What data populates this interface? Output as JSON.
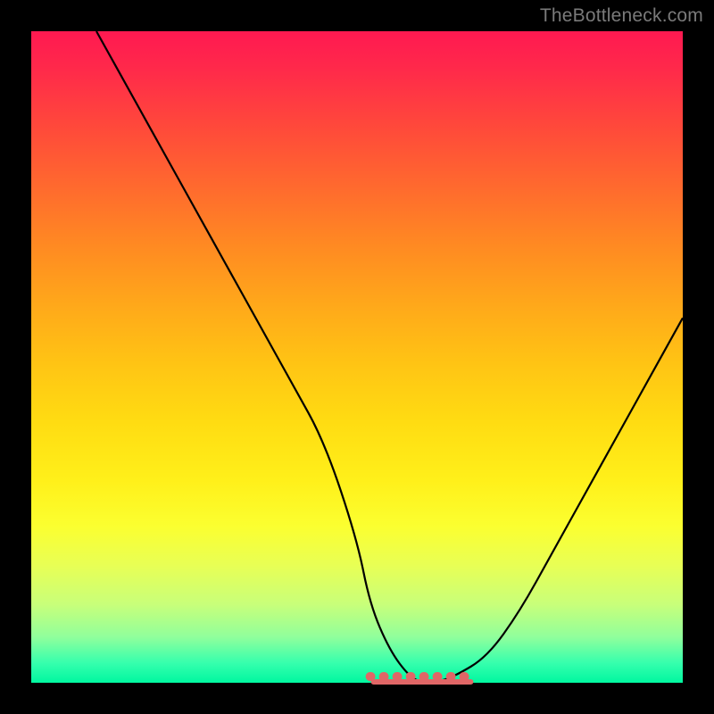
{
  "watermark": "TheBottleneck.com",
  "colors": {
    "curve": "#000000",
    "bottom_marker": "#e06666",
    "gradient_top": "#ff1951",
    "gradient_bottom": "#00f7a0",
    "frame": "#000000"
  },
  "chart_data": {
    "type": "line",
    "title": "",
    "xlabel": "",
    "ylabel": "",
    "xlim": [
      0,
      100
    ],
    "ylim": [
      0,
      100
    ],
    "grid": false,
    "legend": false,
    "series": [
      {
        "name": "bottleneck-curve",
        "x": [
          10,
          15,
          20,
          25,
          30,
          35,
          40,
          45,
          50,
          52,
          55,
          58,
          60,
          62,
          65,
          70,
          75,
          80,
          85,
          90,
          95,
          100
        ],
        "values": [
          100,
          91,
          82,
          73,
          64,
          55,
          46,
          37,
          22,
          12,
          5,
          1,
          0,
          0,
          1,
          4,
          11,
          20,
          29,
          38,
          47,
          56
        ]
      }
    ],
    "annotations": [
      {
        "name": "flat-bottom-marker",
        "color": "#e06666",
        "x_range": [
          52,
          68
        ],
        "y": 0
      }
    ]
  }
}
